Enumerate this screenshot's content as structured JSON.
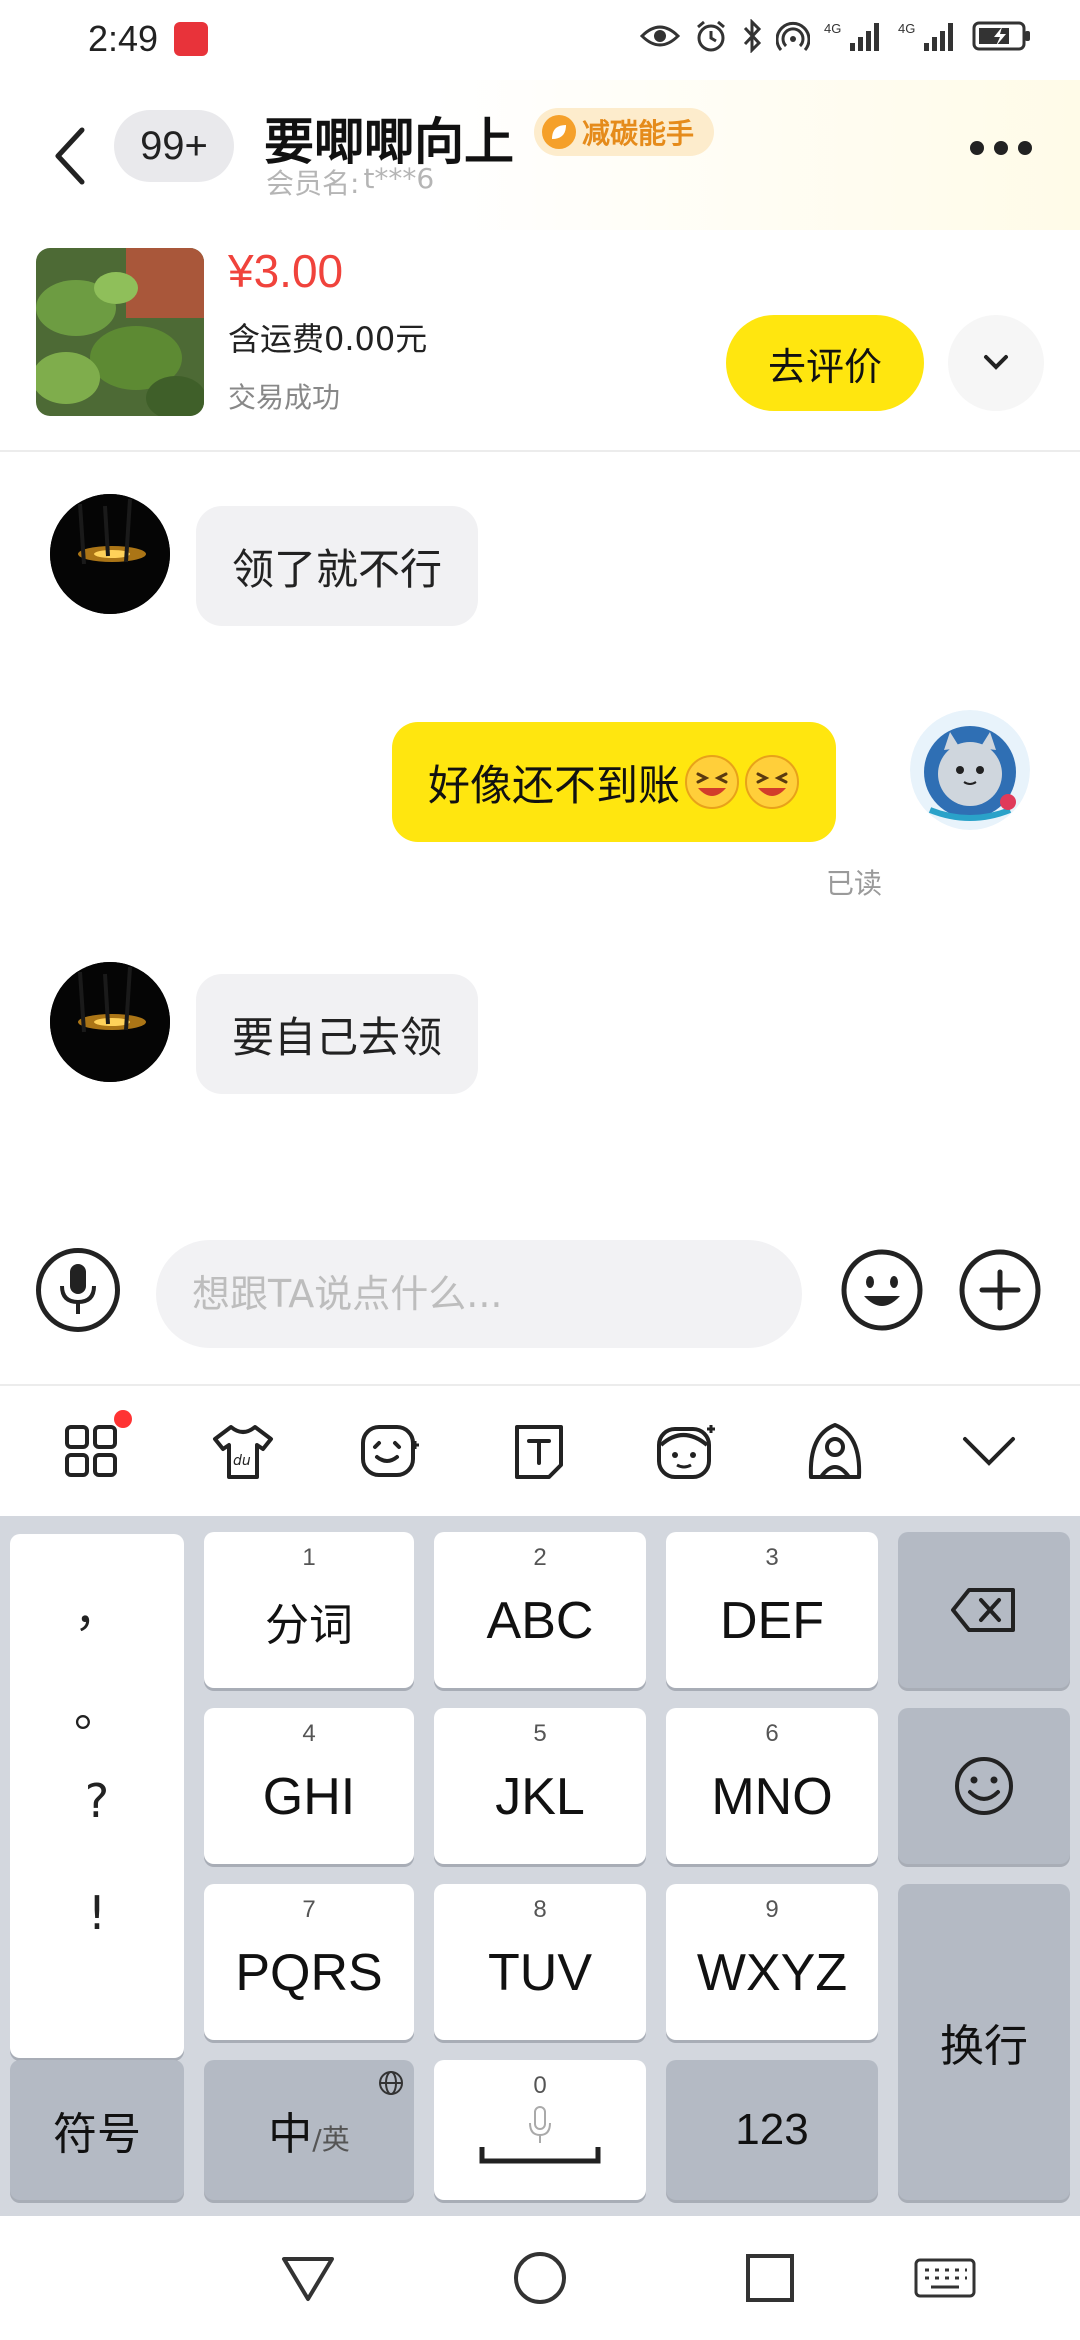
{
  "status_bar": {
    "time": "2:49",
    "network": "4G",
    "network2": "4G"
  },
  "header": {
    "badge": "99+",
    "title": "要唧唧向上",
    "tag": "减碳能手",
    "member_label": "会员名:",
    "member_name": "t***6"
  },
  "product": {
    "price": "¥3.00",
    "shipping": "含运费0.00元",
    "status": "交易成功",
    "review_button": "去评价"
  },
  "messages": [
    {
      "side": "left",
      "text": "领了就不行"
    },
    {
      "side": "right",
      "text": "好像还不到账",
      "read": "已读"
    },
    {
      "side": "left",
      "text": "要自己去领"
    }
  ],
  "input": {
    "placeholder": "想跟TA说点什么..."
  },
  "keyboard": {
    "punctuation": [
      "，",
      "。",
      "?",
      "!"
    ],
    "keys_row1": [
      {
        "num": "1",
        "label": "分词"
      },
      {
        "num": "2",
        "label": "ABC"
      },
      {
        "num": "3",
        "label": "DEF"
      }
    ],
    "keys_row2": [
      {
        "num": "4",
        "label": "GHI"
      },
      {
        "num": "5",
        "label": "JKL"
      },
      {
        "num": "6",
        "label": "MNO"
      }
    ],
    "keys_row3": [
      {
        "num": "7",
        "label": "PQRS"
      },
      {
        "num": "8",
        "label": "TUV"
      },
      {
        "num": "9",
        "label": "WXYZ"
      }
    ],
    "symbols": "符号",
    "lang_main": "中",
    "lang_alt": "/英",
    "space_num": "0",
    "num_key": "123",
    "enter": "换行"
  },
  "colors": {
    "accent_yellow": "#ffe60f",
    "price_red": "#f0433c",
    "tag_orange": "#e58b1b"
  }
}
